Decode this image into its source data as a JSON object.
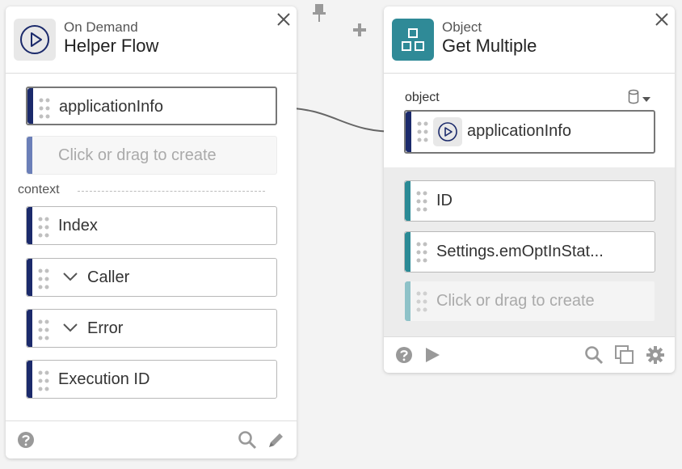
{
  "left_card": {
    "subtitle": "On Demand",
    "title": "Helper Flow",
    "fields": [
      "applicationInfo"
    ],
    "create_placeholder": "Click or drag to create",
    "section_label": "context",
    "context_fields": [
      "Index",
      "Caller",
      "Error",
      "Execution ID"
    ]
  },
  "right_card": {
    "subtitle": "Object",
    "title": "Get Multiple",
    "object_label": "object",
    "object_field": "applicationInfo",
    "fields": [
      "ID",
      "Settings.emOptInStat..."
    ],
    "create_placeholder": "Click or drag to create"
  },
  "colors": {
    "navy": "#1b2a6b",
    "teal": "#2a8a95",
    "teal_light": "#8ec2c8",
    "navy_light": "#6b7fb8",
    "header_icon_teal": "#2f8a97"
  },
  "icons": [
    "play-circle-icon",
    "close-icon",
    "pin-icon",
    "plus-icon",
    "grid-icon",
    "database-icon",
    "help-icon",
    "play-icon",
    "search-icon",
    "copy-icon",
    "gear-icon",
    "pencil-icon"
  ]
}
